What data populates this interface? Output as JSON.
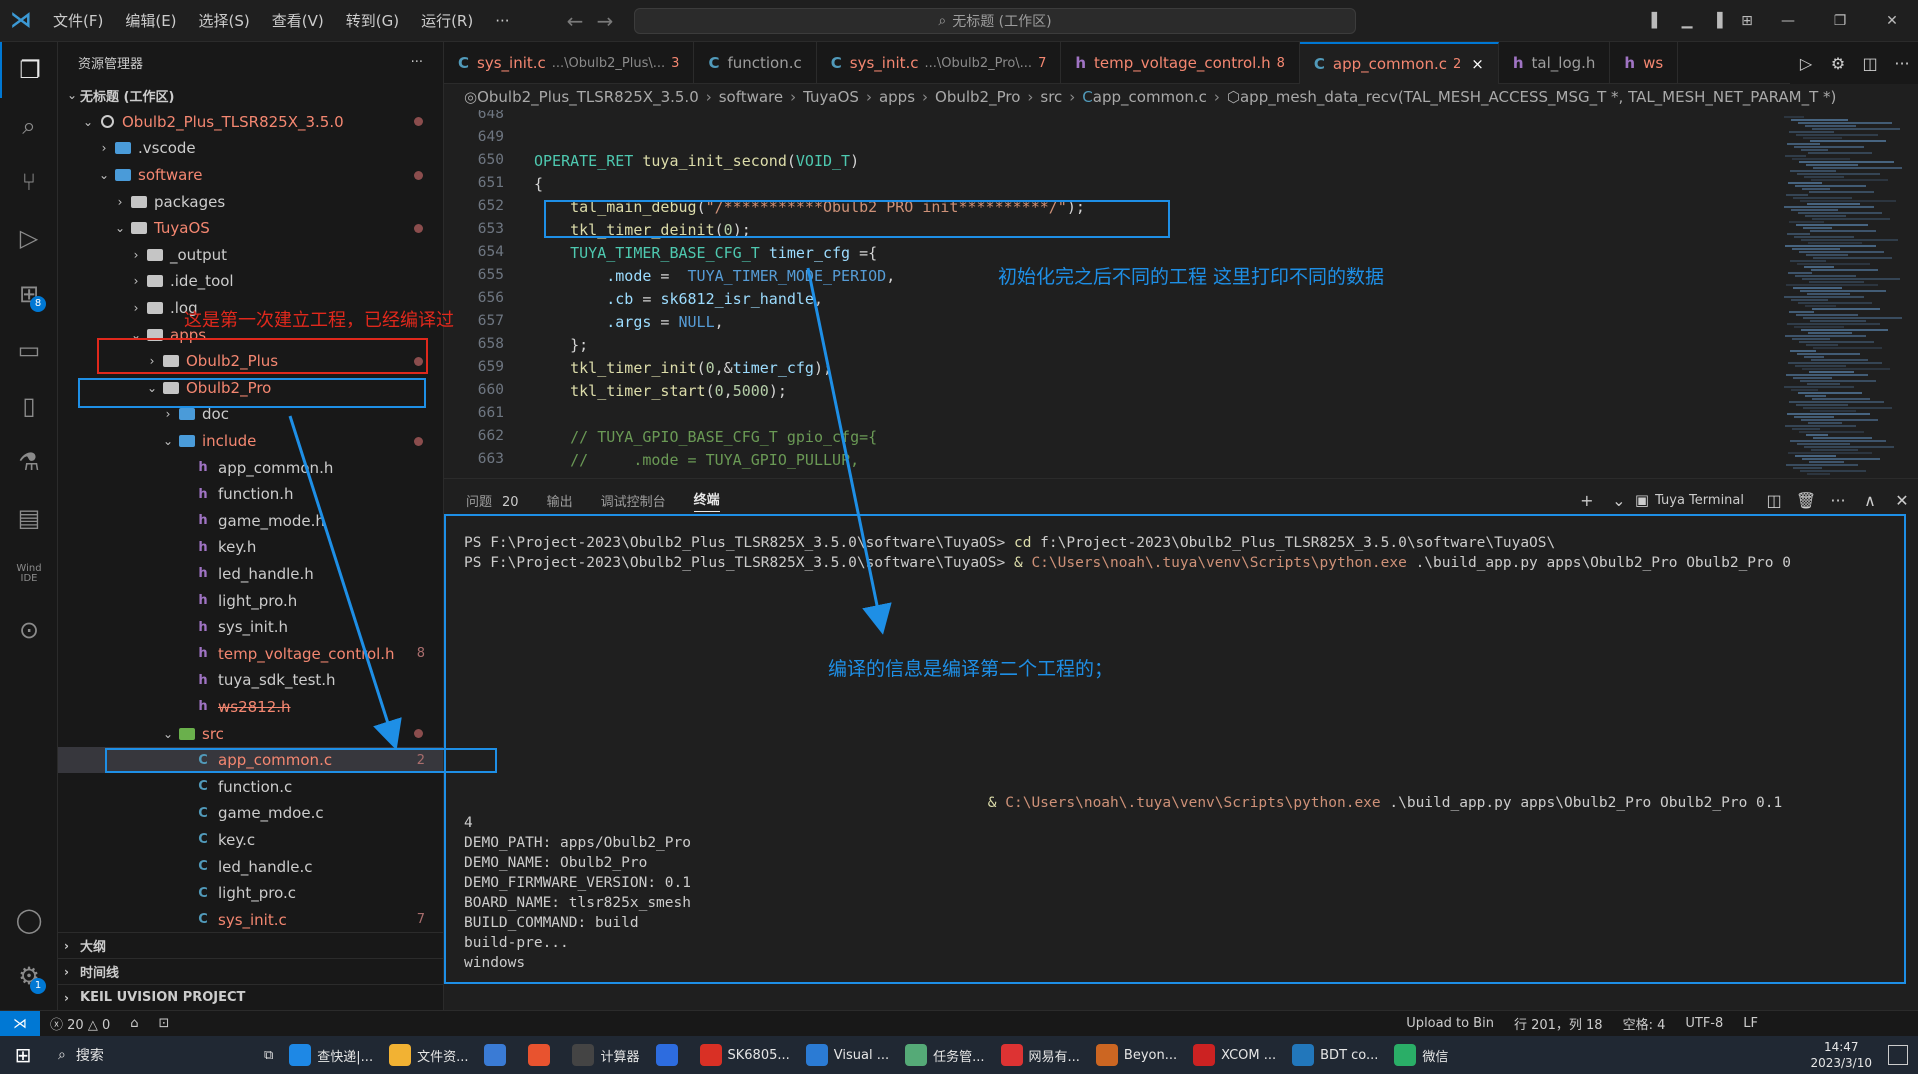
{
  "menu": [
    "文件(F)",
    "编辑(E)",
    "选择(S)",
    "查看(V)",
    "转到(G)",
    "运行(R)",
    "···"
  ],
  "search_box": "无标题 (工作区)",
  "sidebar": {
    "title": "资源管理器",
    "more": "···"
  },
  "tree": [
    {
      "depth": 0,
      "arrow": "v",
      "icon": "none",
      "label": "无标题 (工作区)",
      "bold": true
    },
    {
      "depth": 1,
      "arrow": "v",
      "icon": "circle",
      "label": "Obulb2_Plus_TLSR825X_3.5.0",
      "color": "red",
      "dot": true
    },
    {
      "depth": 2,
      "arrow": ">",
      "icon": "folder-blue",
      "label": ".vscode"
    },
    {
      "depth": 2,
      "arrow": "v",
      "icon": "folder-blue",
      "label": "software",
      "color": "red",
      "dot": true
    },
    {
      "depth": 3,
      "arrow": ">",
      "icon": "folder",
      "label": "packages"
    },
    {
      "depth": 3,
      "arrow": "v",
      "icon": "folder",
      "label": "TuyaOS",
      "color": "red",
      "dot": true
    },
    {
      "depth": 4,
      "arrow": ">",
      "icon": "folder",
      "label": "_output"
    },
    {
      "depth": 4,
      "arrow": ">",
      "icon": "folder",
      "label": ".ide_tool"
    },
    {
      "depth": 4,
      "arrow": ">",
      "icon": "folder",
      "label": ".log"
    },
    {
      "depth": 4,
      "arrow": "v",
      "icon": "folder",
      "label": "apps",
      "color": "red"
    },
    {
      "depth": 5,
      "arrow": ">",
      "icon": "folder",
      "label": "Obulb2_Plus",
      "color": "red",
      "dot": true
    },
    {
      "depth": 5,
      "arrow": "v",
      "icon": "folder",
      "label": "Obulb2_Pro",
      "color": "red"
    },
    {
      "depth": 6,
      "arrow": ">",
      "icon": "folder-blue",
      "label": "doc"
    },
    {
      "depth": 6,
      "arrow": "v",
      "icon": "folder-blue",
      "label": "include",
      "color": "red",
      "dot": true
    },
    {
      "depth": 7,
      "arrow": "",
      "icon": "h",
      "label": "app_common.h"
    },
    {
      "depth": 7,
      "arrow": "",
      "icon": "h",
      "label": "function.h"
    },
    {
      "depth": 7,
      "arrow": "",
      "icon": "h",
      "label": "game_mode.h"
    },
    {
      "depth": 7,
      "arrow": "",
      "icon": "h",
      "label": "key.h"
    },
    {
      "depth": 7,
      "arrow": "",
      "icon": "h",
      "label": "led_handle.h"
    },
    {
      "depth": 7,
      "arrow": "",
      "icon": "h",
      "label": "light_pro.h"
    },
    {
      "depth": 7,
      "arrow": "",
      "icon": "h",
      "label": "sys_init.h"
    },
    {
      "depth": 7,
      "arrow": "",
      "icon": "h",
      "label": "temp_voltage_control.h",
      "color": "red",
      "badge": "8"
    },
    {
      "depth": 7,
      "arrow": "",
      "icon": "h",
      "label": "tuya_sdk_test.h"
    },
    {
      "depth": 7,
      "arrow": "",
      "icon": "h",
      "label": "ws2812.h",
      "color": "red",
      "strike": true
    },
    {
      "depth": 6,
      "arrow": "v",
      "icon": "folder-green",
      "label": "src",
      "color": "red",
      "dot": true
    },
    {
      "depth": 7,
      "arrow": "",
      "icon": "c",
      "label": "app_common.c",
      "color": "red",
      "badge": "2",
      "selected": true
    },
    {
      "depth": 7,
      "arrow": "",
      "icon": "c",
      "label": "function.c"
    },
    {
      "depth": 7,
      "arrow": "",
      "icon": "c",
      "label": "game_mdoe.c"
    },
    {
      "depth": 7,
      "arrow": "",
      "icon": "c",
      "label": "key.c"
    },
    {
      "depth": 7,
      "arrow": "",
      "icon": "c",
      "label": "led_handle.c"
    },
    {
      "depth": 7,
      "arrow": "",
      "icon": "c",
      "label": "light_pro.c"
    },
    {
      "depth": 7,
      "arrow": "",
      "icon": "c",
      "label": "sys_init.c",
      "color": "red",
      "badge": "7"
    }
  ],
  "sidebar_sections": [
    "大纲",
    "时间线",
    "KEIL UVISION PROJECT"
  ],
  "tabs": [
    {
      "icon": "C",
      "name": "sys_init.c",
      "sub": "...\\Obulb2_Plus\\...",
      "num": "3",
      "red": true
    },
    {
      "icon": "C",
      "name": "function.c",
      "sub": "",
      "num": "",
      "red": false
    },
    {
      "icon": "C",
      "name": "sys_init.c",
      "sub": "...\\Obulb2_Pro\\...",
      "num": "7",
      "red": true
    },
    {
      "icon": "h",
      "name": "temp_voltage_control.h",
      "sub": "",
      "num": "8",
      "red": true
    },
    {
      "icon": "C",
      "name": "app_common.c",
      "sub": "",
      "num": "2",
      "red": true,
      "active": true,
      "close": "×"
    },
    {
      "icon": "h",
      "name": "tal_log.h",
      "sub": "",
      "num": "",
      "red": false
    },
    {
      "icon": "h",
      "name": "ws",
      "sub": "",
      "num": "",
      "red": true
    }
  ],
  "breadcrumb": [
    "Obulb2_Plus_TLSR825X_3.5.0",
    "software",
    "TuyaOS",
    "apps",
    "Obulb2_Pro",
    "src",
    "app_common.c",
    "app_mesh_data_recv(TAL_MESH_ACCESS_MSG_T *, TAL_MESH_NET_PARAM_T *)"
  ],
  "code": [
    {
      "n": "648",
      "t": ""
    },
    {
      "n": "649",
      "t": ""
    },
    {
      "n": "650",
      "t": "OPERATE_RET tuya_init_second(VOID_T)"
    },
    {
      "n": "651",
      "t": "{"
    },
    {
      "n": "652",
      "t": "    tal_main_debug(\"/***********Obulb2 PRO init**********/\");"
    },
    {
      "n": "653",
      "t": "    tkl_timer_deinit(0);"
    },
    {
      "n": "654",
      "t": "    TUYA_TIMER_BASE_CFG_T timer_cfg ={"
    },
    {
      "n": "655",
      "t": "        .mode =  TUYA_TIMER_MODE_PERIOD,"
    },
    {
      "n": "656",
      "t": "        .cb = sk6812_isr_handle,"
    },
    {
      "n": "657",
      "t": "        .args = NULL,"
    },
    {
      "n": "658",
      "t": "    };"
    },
    {
      "n": "659",
      "t": "    tkl_timer_init(0,&timer_cfg);"
    },
    {
      "n": "660",
      "t": "    tkl_timer_start(0,5000);"
    },
    {
      "n": "661",
      "t": ""
    },
    {
      "n": "662",
      "t": "    // TUYA_GPIO_BASE_CFG_T gpio_cfg={"
    },
    {
      "n": "663",
      "t": "    //     .mode = TUYA_GPIO_PULLUP,"
    }
  ],
  "panel": {
    "tabs": [
      "问题",
      "输出",
      "调试控制台",
      "终端"
    ],
    "problems_count": "20",
    "terminal_name": "Tuya Terminal"
  },
  "terminal": [
    {
      "pre": "PS F:\\Project-2023\\Obulb2_Plus_TLSR825X_3.5.0\\software\\TuyaOS> ",
      "cmd": "cd",
      "rest": " f:\\Project-2023\\Obulb2_Plus_TLSR825X_3.5.0\\software\\TuyaOS\\"
    },
    {
      "pre": "PS F:\\Project-2023\\Obulb2_Plus_TLSR825X_3.5.0\\software\\TuyaOS> ",
      "cmd": "& ",
      "path": "C:\\Users\\noah\\.tuya\\venv\\Scripts\\python.exe",
      "rest": " .\\build_app.py apps\\Obulb2_Pro Obulb2_Pro 0"
    },
    {
      "pre": "",
      "rest": ""
    },
    {
      "pre": "",
      "rest": ""
    },
    {
      "pre": "",
      "rest": ""
    },
    {
      "pre": "",
      "rest": ""
    },
    {
      "pre": "",
      "rest": ""
    },
    {
      "pre": "",
      "rest": ""
    },
    {
      "pre": "",
      "rest": ""
    },
    {
      "pre": "",
      "rest": ""
    },
    {
      "pre": "",
      "rest": ""
    },
    {
      "pre": "",
      "rest": ""
    },
    {
      "pre": "",
      "rest": ""
    },
    {
      "pre": "                                                            ",
      "cmd": "& ",
      "path": "C:\\Users\\noah\\.tuya\\venv\\Scripts\\python.exe",
      "rest": " .\\build_app.py apps\\Obulb2_Pro Obulb2_Pro 0.1"
    },
    {
      "pre": "",
      "rest": "4"
    },
    {
      "pre": "",
      "rest": "DEMO_PATH: apps/Obulb2_Pro"
    },
    {
      "pre": "",
      "rest": "DEMO_NAME: Obulb2_Pro"
    },
    {
      "pre": "",
      "rest": "DEMO_FIRMWARE_VERSION: 0.1"
    },
    {
      "pre": "",
      "rest": "BOARD_NAME: tlsr825x_smesh"
    },
    {
      "pre": "",
      "rest": "BUILD_COMMAND: build"
    },
    {
      "pre": "",
      "rest": "build-pre..."
    },
    {
      "pre": "",
      "rest": "windows"
    }
  ],
  "annotations": {
    "first_project": "这是第一次建立工程，已经编译过",
    "print_diff": "初始化完之后不同的工程 这里打印不同的数据",
    "compile_info": "编译的信息是编译第二个工程的；"
  },
  "status": {
    "errors": "20",
    "warnings": "0",
    "upload": "Upload to Bin",
    "position": "行 201，列 18",
    "spaces": "空格: 4",
    "encoding": "UTF-8",
    "eol": "LF"
  },
  "taskbar": {
    "search": "搜索",
    "apps": [
      {
        "label": "查快递|...",
        "color": "#1e88e5"
      },
      {
        "label": "文件资...",
        "color": "#f2b233"
      },
      {
        "label": "",
        "color": "#3a7bd5"
      },
      {
        "label": "",
        "color": "#e8532f"
      },
      {
        "label": "计算器",
        "color": "#444"
      },
      {
        "label": "",
        "color": "#2d6cdf"
      },
      {
        "label": "SK6805...",
        "color": "#d93025"
      },
      {
        "label": "Visual ...",
        "color": "#2b7bd4"
      },
      {
        "label": "任务管...",
        "color": "#5a7"
      },
      {
        "label": "网易有...",
        "color": "#d33"
      },
      {
        "label": "Beyon...",
        "color": "#c62"
      },
      {
        "label": "XCOM ...",
        "color": "#c22"
      },
      {
        "label": "BDT co...",
        "color": "#27b"
      },
      {
        "label": "微信",
        "color": "#2aae67"
      }
    ],
    "time": "14:47",
    "date": "2023/3/10"
  }
}
